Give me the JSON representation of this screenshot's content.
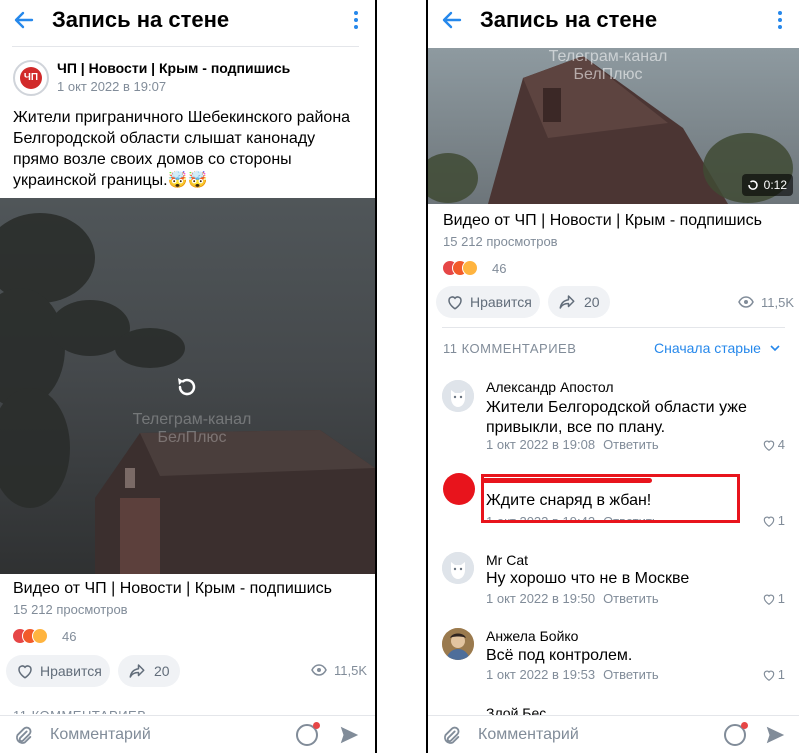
{
  "header": {
    "title": "Запись на стене"
  },
  "post": {
    "source": "ЧП | Новости | Крым - подпишись",
    "source_avatar_text": "ЧП",
    "date": "1 окт 2022 в 19:07",
    "text": "Жители приграничного Шебекинского района Белгородской области слышат канонаду прямо возле своих домов со стороны украинской границы.🤯🤯"
  },
  "video": {
    "watermark_line1": "Телеграм-канал",
    "watermark_line2": "БелПлюс",
    "duration": "0:12",
    "title": "Видео от ЧП | Новости | Крым - подпишись",
    "views": "15 212 просмотров",
    "reactions_count": "46",
    "reaction_colors": [
      "#e64646",
      "#f25a2a",
      "#ffb43f"
    ]
  },
  "actions": {
    "like_label": "Нравится",
    "share_count": "20",
    "views_count": "11,5K"
  },
  "comments": {
    "count_label": "11 КОММЕНТАРИЕВ",
    "sort_label": "Сначала старые",
    "reply_label": "Ответить",
    "partial_header_left": "11 КОММЕНТАРИЕВ",
    "items": [
      {
        "name": "Александр Апостол",
        "text": "Жители Белгородской области уже привыкли, все по плану.",
        "date": "1 окт 2022 в 19:08",
        "likes": "4"
      },
      {
        "name": "",
        "text": "Ждите снаряд в жбан!",
        "date": "1 окт 2022 в 19:42",
        "likes": "1"
      },
      {
        "name": "Mr Cat",
        "text": "Ну хорошо что не в Москве",
        "date": "1 окт 2022 в 19:50",
        "likes": "1"
      },
      {
        "name": "Анжела Бойко",
        "text": "Всё под контролем.",
        "date": "1 окт 2022 в 19:53",
        "likes": "1"
      },
      {
        "name": "Злой Бес",
        "text": "",
        "date": "",
        "likes": ""
      }
    ]
  },
  "composer": {
    "placeholder": "Комментарий"
  },
  "colors": {
    "accent": "#2688eb",
    "annotation_red": "#e8141c"
  }
}
